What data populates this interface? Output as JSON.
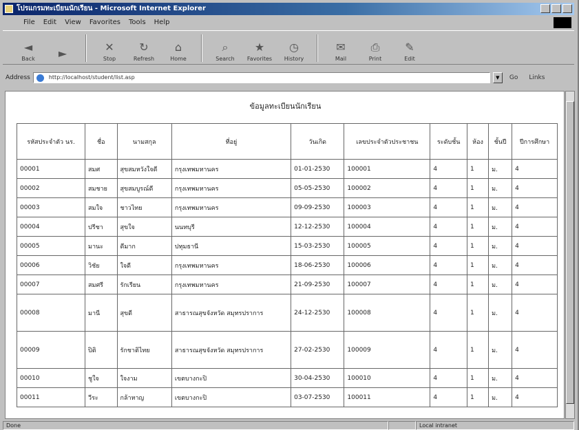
{
  "window": {
    "title": "โปรแกรมทะเบียนนักเรียน - Microsoft Internet Explorer"
  },
  "menu": [
    "File",
    "Edit",
    "View",
    "Favorites",
    "Tools",
    "Help"
  ],
  "toolbar": [
    {
      "label": "Back",
      "icon": "back-icon",
      "glyph": "◄"
    },
    {
      "label": "",
      "icon": "forward-icon",
      "glyph": "►"
    },
    {
      "label": "Stop",
      "icon": "stop-icon",
      "glyph": "✕"
    },
    {
      "label": "Refresh",
      "icon": "refresh-icon",
      "glyph": "↻"
    },
    {
      "label": "Home",
      "icon": "home-icon",
      "glyph": "⌂"
    },
    {
      "label": "Search",
      "icon": "search-icon",
      "glyph": "⌕"
    },
    {
      "label": "Favorites",
      "icon": "favorites-icon",
      "glyph": "★"
    },
    {
      "label": "History",
      "icon": "history-icon",
      "glyph": "◷"
    },
    {
      "label": "Mail",
      "icon": "mail-icon",
      "glyph": "✉"
    },
    {
      "label": "Print",
      "icon": "print-icon",
      "glyph": "⎙"
    },
    {
      "label": "Edit",
      "icon": "edit-icon",
      "glyph": "✎"
    }
  ],
  "address": {
    "label": "Address",
    "url": "http://localhost/student/list.asp",
    "go": "Go",
    "links": "Links"
  },
  "page": {
    "heading": "ข้อมูลทะเบียนนักเรียน"
  },
  "table": {
    "headers": [
      "รหัสประจำตัว นร.",
      "ชื่อ",
      "นามสกุล",
      "ที่อยู่",
      "วันเกิด",
      "เลขประจำตัวประชาชน",
      "ระดับชั้น",
      "ห้อง",
      "ชั้นปี",
      "ปีการศึกษา"
    ],
    "rows": [
      [
        "00001",
        "สมศ",
        "สุขสมหวังใจดี",
        "กรุงเทพมหานคร",
        "01-01-2530",
        "100001",
        "4",
        "1",
        "ม.",
        "4"
      ],
      [
        "00002",
        "สมชาย",
        "สุขสมบูรณ์ดี",
        "กรุงเทพมหานคร",
        "05-05-2530",
        "100002",
        "4",
        "1",
        "ม.",
        "4"
      ],
      [
        "00003",
        "สมใจ",
        "ชาวไทย",
        "กรุงเทพมหานคร",
        "09-09-2530",
        "100003",
        "4",
        "1",
        "ม.",
        "4"
      ],
      [
        "00004",
        "ปรีชา",
        "สุขใจ",
        "นนทบุรี",
        "12-12-2530",
        "100004",
        "4",
        "1",
        "ม.",
        "4"
      ],
      [
        "00005",
        "มานะ",
        "ดีมาก",
        "ปทุมธานี",
        "15-03-2530",
        "100005",
        "4",
        "1",
        "ม.",
        "4"
      ],
      [
        "00006",
        "วิชัย",
        "ใจดี",
        "กรุงเทพมหานคร",
        "18-06-2530",
        "100006",
        "4",
        "1",
        "ม.",
        "4"
      ],
      [
        "00007",
        "สมศรี",
        "รักเรียน",
        "กรุงเทพมหานคร",
        "21-09-2530",
        "100007",
        "4",
        "1",
        "ม.",
        "4"
      ],
      [
        "00008",
        "มานี",
        "สุขดี",
        "สาธารณสุขจังหวัด สมุทรปราการ",
        "24-12-2530",
        "100008",
        "4",
        "1",
        "ม.",
        "4"
      ],
      [
        "00009",
        "ปิติ",
        "รักชาติไทย",
        "สาธารณสุขจังหวัด สมุทรปราการ",
        "27-02-2530",
        "100009",
        "4",
        "1",
        "ม.",
        "4"
      ],
      [
        "00010",
        "ชูใจ",
        "ใจงาม",
        "เขตบางกะปิ",
        "30-04-2530",
        "100010",
        "4",
        "1",
        "ม.",
        "4"
      ],
      [
        "00011",
        "วีระ",
        "กล้าหาญ",
        "เขตบางกะปิ",
        "03-07-2530",
        "100011",
        "4",
        "1",
        "ม.",
        "4"
      ]
    ]
  },
  "status": {
    "left": "Done",
    "zone": "Local intranet"
  }
}
